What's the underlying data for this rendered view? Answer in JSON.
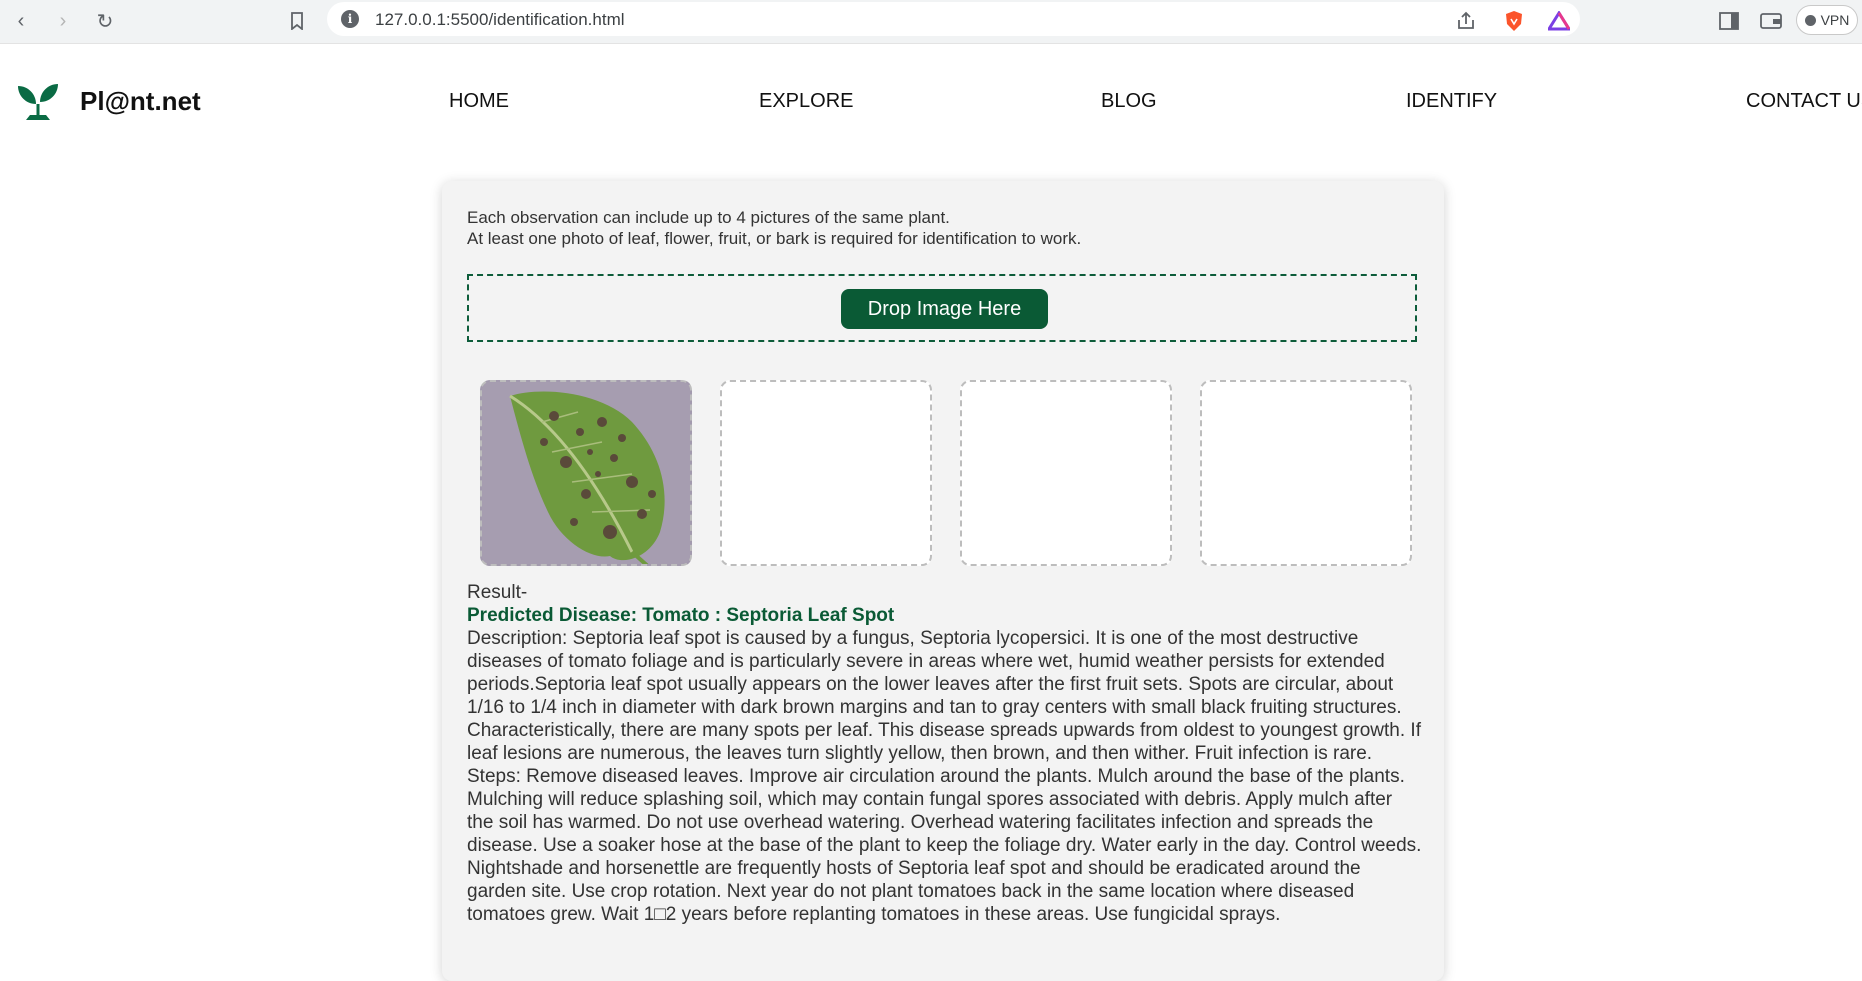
{
  "browser": {
    "url": "127.0.0.1:5500/identification.html",
    "vpn_label": "VPN"
  },
  "site": {
    "brand": "Pl@nt.net",
    "nav": [
      "HOME",
      "EXPLORE",
      "BLOG",
      "IDENTIFY",
      "CONTACT US"
    ]
  },
  "upload": {
    "instruction_line1": "Each observation can include up to 4 pictures of the same plant.",
    "instruction_line2": "At least one photo of leaf, flower, fruit, or bark is required for identification to work.",
    "drop_button": "Drop Image Here"
  },
  "result": {
    "heading": "Result-",
    "prediction": "Predicted Disease: Tomato : Septoria Leaf Spot",
    "description": "Description: Septoria leaf spot is caused by a fungus, Septoria lycopersici. It is one of the most destructive diseases of tomato foliage and is particularly severe in areas where wet, humid weather persists for extended periods.Septoria leaf spot usually appears on the lower leaves after the first fruit sets. Spots are circular, about 1/16 to 1/4 inch in diameter with dark brown margins and tan to gray centers with small black fruiting structures. Characteristically, there are many spots per leaf. This disease spreads upwards from oldest to youngest growth. If leaf lesions are numerous, the leaves turn slightly yellow, then brown, and then wither. Fruit infection is rare.",
    "steps": "Steps: Remove diseased leaves. Improve air circulation around the plants. Mulch around the base of the plants. Mulching will reduce splashing soil, which may contain fungal spores associated with debris. Apply mulch after the soil has warmed. Do not use overhead watering. Overhead watering facilitates infection and spreads the disease. Use a soaker hose at the base of the plant to keep the foliage dry. Water early in the day. Control weeds. Nightshade and horsenettle are frequently hosts of Septoria leaf spot and should be eradicated around the garden site. Use crop rotation. Next year do not plant tomatoes back in the same location where diseased tomatoes grew. Wait 1□2 years before replanting tomatoes in these areas. Use fungicidal sprays."
  },
  "colors": {
    "brand_green": "#0a5a35",
    "card_bg": "#f3f3f3"
  }
}
